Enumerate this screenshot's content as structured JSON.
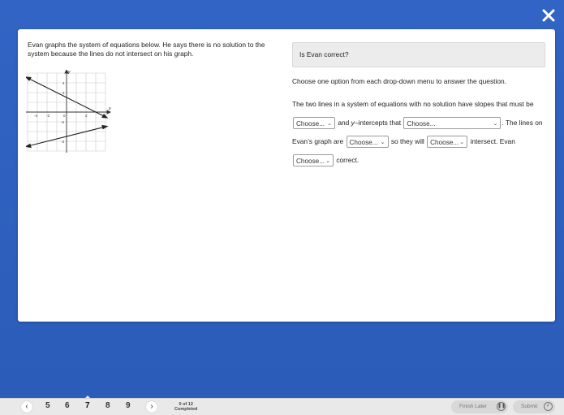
{
  "question": {
    "left_text": "Evan graphs the system of equations below. He says there is no solution to the system because the lines do not intersect on his graph.",
    "prompt": "Is Evan correct?",
    "instructions": "Choose one option from each drop-down menu to answer the question.",
    "sentence": {
      "part1": "The two lines in a system of equations with no solution have slopes that must be",
      "part2": "and",
      "part2_italic": "y",
      "part2_rest": "–intercepts that",
      "part3": ". The lines on Evan’s graph are",
      "part4": "so they will",
      "part5": "intersect. Evan",
      "part6": "correct."
    },
    "dropdowns": [
      "Choose...",
      "Choose...",
      "Choose...",
      "Choose...",
      "Choose..."
    ]
  },
  "graph": {
    "x_ticks": [
      "-4",
      "-2",
      "0",
      "2",
      "4"
    ],
    "y_ticks": [
      "4",
      "2",
      "-2",
      "-4"
    ],
    "x_label": "x",
    "y_label": "y"
  },
  "footer": {
    "prev_icon": "chevron-left-icon",
    "next_icon": "chevron-right-icon",
    "pages": [
      "5",
      "6",
      "7",
      "8",
      "9"
    ],
    "active_page": "7",
    "progress_line1": "0 of 12",
    "progress_line2": "Completed",
    "finish_later": "Finish Later",
    "submit": "Submit"
  },
  "colors": {
    "header_blue": "#2f60c0",
    "footer_gray": "#e9e9e9"
  }
}
